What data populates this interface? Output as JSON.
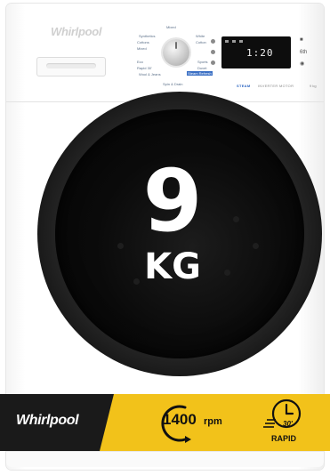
{
  "brand": {
    "logo_text": "Whirlpool"
  },
  "control_panel": {
    "program_top_label": "Mixed",
    "program_bottom_label": "Spin & Drain",
    "programs_left": [
      "Synthetics",
      "Cottons",
      "Mixed",
      "",
      "Eco",
      "Rapid 30'",
      "Wool & Jeans"
    ],
    "programs_right": [
      "White",
      "Cotton",
      "",
      "",
      "Sports",
      "Duvet",
      "Steam Refresh"
    ],
    "highlighted_program": "Steam Refresh",
    "display_value": "1:20",
    "side_button_label": "6th",
    "steam_label": "STEAM",
    "inverter_label": "INVERTER MOTOR",
    "capacity_small": "9 kg"
  },
  "door": {
    "capacity_number": "9",
    "capacity_unit": "KG"
  },
  "banner": {
    "brand": "Whirlpool",
    "spin_value": "1400",
    "spin_unit": "rpm",
    "rapid_time": "30'",
    "rapid_label": "RAPID"
  },
  "colors": {
    "banner_black": "#1a1a1a",
    "banner_yellow": "#f2c21a",
    "steam_blue": "#2d66c2",
    "door": "#000000"
  },
  "icons": [
    "knob-icon",
    "clock-icon",
    "spin-arrow-icon"
  ]
}
